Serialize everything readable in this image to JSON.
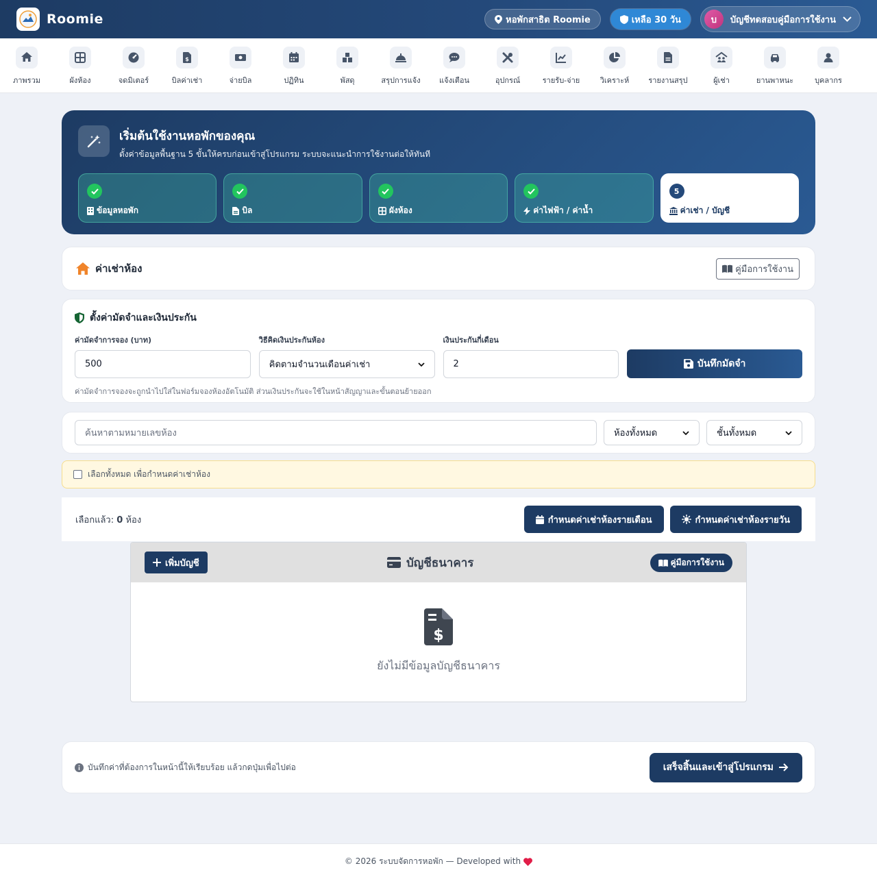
{
  "header": {
    "brand": "Roomie",
    "location_label": "หอพักสาธิต Roomie",
    "days_left_label": "เหลือ 30 วัน",
    "user_initial": "บ",
    "user_name": "บัญชีทดสอบคู่มือการใช้งาน"
  },
  "nav": {
    "items": [
      {
        "label": "ภาพรวม",
        "icon": "home-icon"
      },
      {
        "label": "ผังห้อง",
        "icon": "grid-icon"
      },
      {
        "label": "จดมิเตอร์",
        "icon": "gauge-icon"
      },
      {
        "label": "บิลค่าเช่า",
        "icon": "invoice-icon"
      },
      {
        "label": "จ่ายบิล",
        "icon": "money-icon"
      },
      {
        "label": "ปฏิทิน",
        "icon": "calendar-icon"
      },
      {
        "label": "พัสดุ",
        "icon": "boxes-icon"
      },
      {
        "label": "สรุปการแจ้ง",
        "icon": "bell-concierge-icon"
      },
      {
        "label": "แจ้งเตือน",
        "icon": "chat-icon"
      },
      {
        "label": "อุปกรณ์",
        "icon": "tools-icon"
      },
      {
        "label": "รายรับ-จ่าย",
        "icon": "chart-line-icon"
      },
      {
        "label": "วิเคราะห์",
        "icon": "pie-chart-icon"
      },
      {
        "label": "รายงานสรุป",
        "icon": "file-icon"
      },
      {
        "label": "ผู้เช่า",
        "icon": "people-roof-icon"
      },
      {
        "label": "ยานพาหนะ",
        "icon": "car-icon"
      },
      {
        "label": "บุคลากร",
        "icon": "user-icon"
      }
    ]
  },
  "hero": {
    "title": "เริ่มต้นใช้งานหอพักของคุณ",
    "subtitle": "ตั้งค่าข้อมูลพื้นฐาน 5 ขั้นให้ครบก่อนเข้าสู่โปรแกรม ระบบจะแนะนำการใช้งานต่อให้ทันที",
    "steps": [
      {
        "label": "ข้อมูลหอพัก",
        "done": true
      },
      {
        "label": "บิล",
        "done": true
      },
      {
        "label": "ผังห้อง",
        "done": true
      },
      {
        "label": "ค่าไฟฟ้า / ค่าน้ำ",
        "done": true
      },
      {
        "label": "ค่าเช่า / บัญชี",
        "done": false,
        "number": "5"
      }
    ]
  },
  "section": {
    "title": "ค่าเช่าห้อง",
    "manual_label": "คู่มือการใช้งาน"
  },
  "deposit": {
    "title": "ตั้งค่ามัดจำและเงินประกัน",
    "booking_label": "ค่ามัดจำการจอง (บาท)",
    "booking_value": "500",
    "method_label": "วิธีคิดเงินประกันห้อง",
    "method_value": "คิดตามจำนวนเดือนค่าเช่า",
    "months_label": "เงินประกันกี่เดือน",
    "months_value": "2",
    "save_label": "บันทึกมัดจำ",
    "hint": "ค่ามัดจำการจองจะถูกนำไปใส่ในฟอร์มจองห้องอัตโนมัติ ส่วนเงินประกันจะใช้ในหน้าสัญญาและขั้นตอนย้ายออก"
  },
  "filters": {
    "search_placeholder": "ค้นหาตามหมายเลขห้อง",
    "room_filter": "ห้องทั้งหมด",
    "floor_filter": "ชั้นทั้งหมด"
  },
  "select_all": {
    "label": "เลือกทั้งหมด เพื่อกำหนดค่าเช่าห้อง"
  },
  "selection": {
    "prefix": "เลือกแล้ว:",
    "count": "0",
    "suffix": "ห้อง",
    "monthly_label": "กำหนดค่าเช่าห้องรายเดือน",
    "daily_label": "กำหนดค่าเช่าห้องรายวัน"
  },
  "bank": {
    "add_label": "เพิ่มบัญชี",
    "title": "บัญชีธนาคาร",
    "manual_label": "คู่มือการใช้งาน",
    "empty_text": "ยังไม่มีข้อมูลบัญชีธนาคาร"
  },
  "finish": {
    "note": "บันทึกค่าที่ต้องการในหน้านี้ให้เรียบร้อย แล้วกดปุ่มเพื่อไปต่อ",
    "button_label": "เสร็จสิ้นและเข้าสู่โปรแกรม"
  },
  "footer": {
    "text": "© 2026 ระบบจัดการหอพัก — Developed with"
  },
  "colors": {
    "primary": "#1d3b63",
    "accent": "#2a5a93",
    "success": "#22c55e",
    "warning_bg": "#fff8e1",
    "heart": "#e11d48"
  }
}
